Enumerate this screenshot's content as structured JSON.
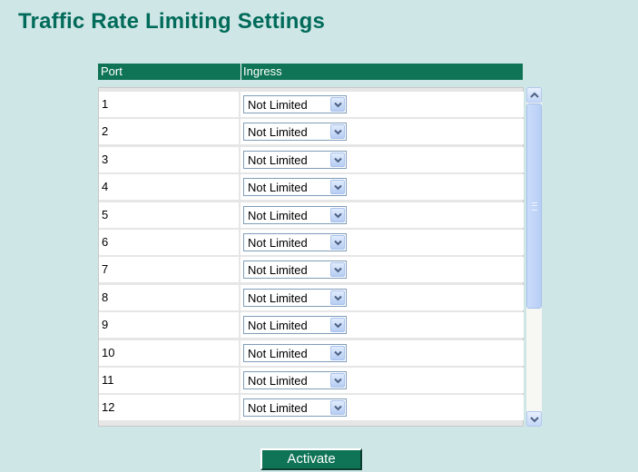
{
  "page": {
    "title": "Traffic Rate Limiting Settings"
  },
  "table": {
    "headers": {
      "port": "Port",
      "ingress": "Ingress"
    },
    "rows": [
      {
        "port": "1",
        "ingress": "Not Limited"
      },
      {
        "port": "2",
        "ingress": "Not Limited"
      },
      {
        "port": "3",
        "ingress": "Not Limited"
      },
      {
        "port": "4",
        "ingress": "Not Limited"
      },
      {
        "port": "5",
        "ingress": "Not Limited"
      },
      {
        "port": "6",
        "ingress": "Not Limited"
      },
      {
        "port": "7",
        "ingress": "Not Limited"
      },
      {
        "port": "8",
        "ingress": "Not Limited"
      },
      {
        "port": "9",
        "ingress": "Not Limited"
      },
      {
        "port": "10",
        "ingress": "Not Limited"
      },
      {
        "port": "11",
        "ingress": "Not Limited"
      },
      {
        "port": "12",
        "ingress": "Not Limited"
      }
    ]
  },
  "actions": {
    "activate_label": "Activate"
  },
  "icons": {
    "dropdown": "chevron-down-icon",
    "scroll_up": "scroll-up-arrow-icon",
    "scroll_down": "scroll-down-arrow-icon"
  },
  "colors": {
    "background": "#cfe6e6",
    "title": "#006b5a",
    "header_bar": "#0f7455",
    "button": "#0f7455"
  }
}
